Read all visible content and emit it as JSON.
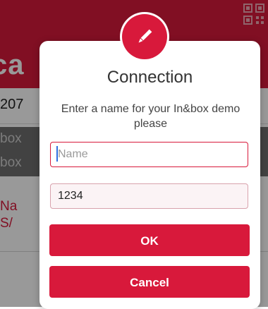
{
  "colors": {
    "accent": "#d8193b",
    "overlay": "rgba(0,0,0,0.40)",
    "text": "#333333"
  },
  "background_app": {
    "header_title_fragment": "ca",
    "qr_icon": "qr-code-icon",
    "field_fragment": "207",
    "inbox_line1": "box",
    "inbox_line2": "box",
    "list_line1": "Na",
    "list_line2": "S/"
  },
  "dialog": {
    "icon": "pencil-icon",
    "title": "Connection",
    "message": "Enter a name for your In&box demo please",
    "name_input": {
      "value": "",
      "placeholder": "Name"
    },
    "code_input": {
      "value": "1234",
      "placeholder": ""
    },
    "ok_label": "OK",
    "cancel_label": "Cancel"
  }
}
